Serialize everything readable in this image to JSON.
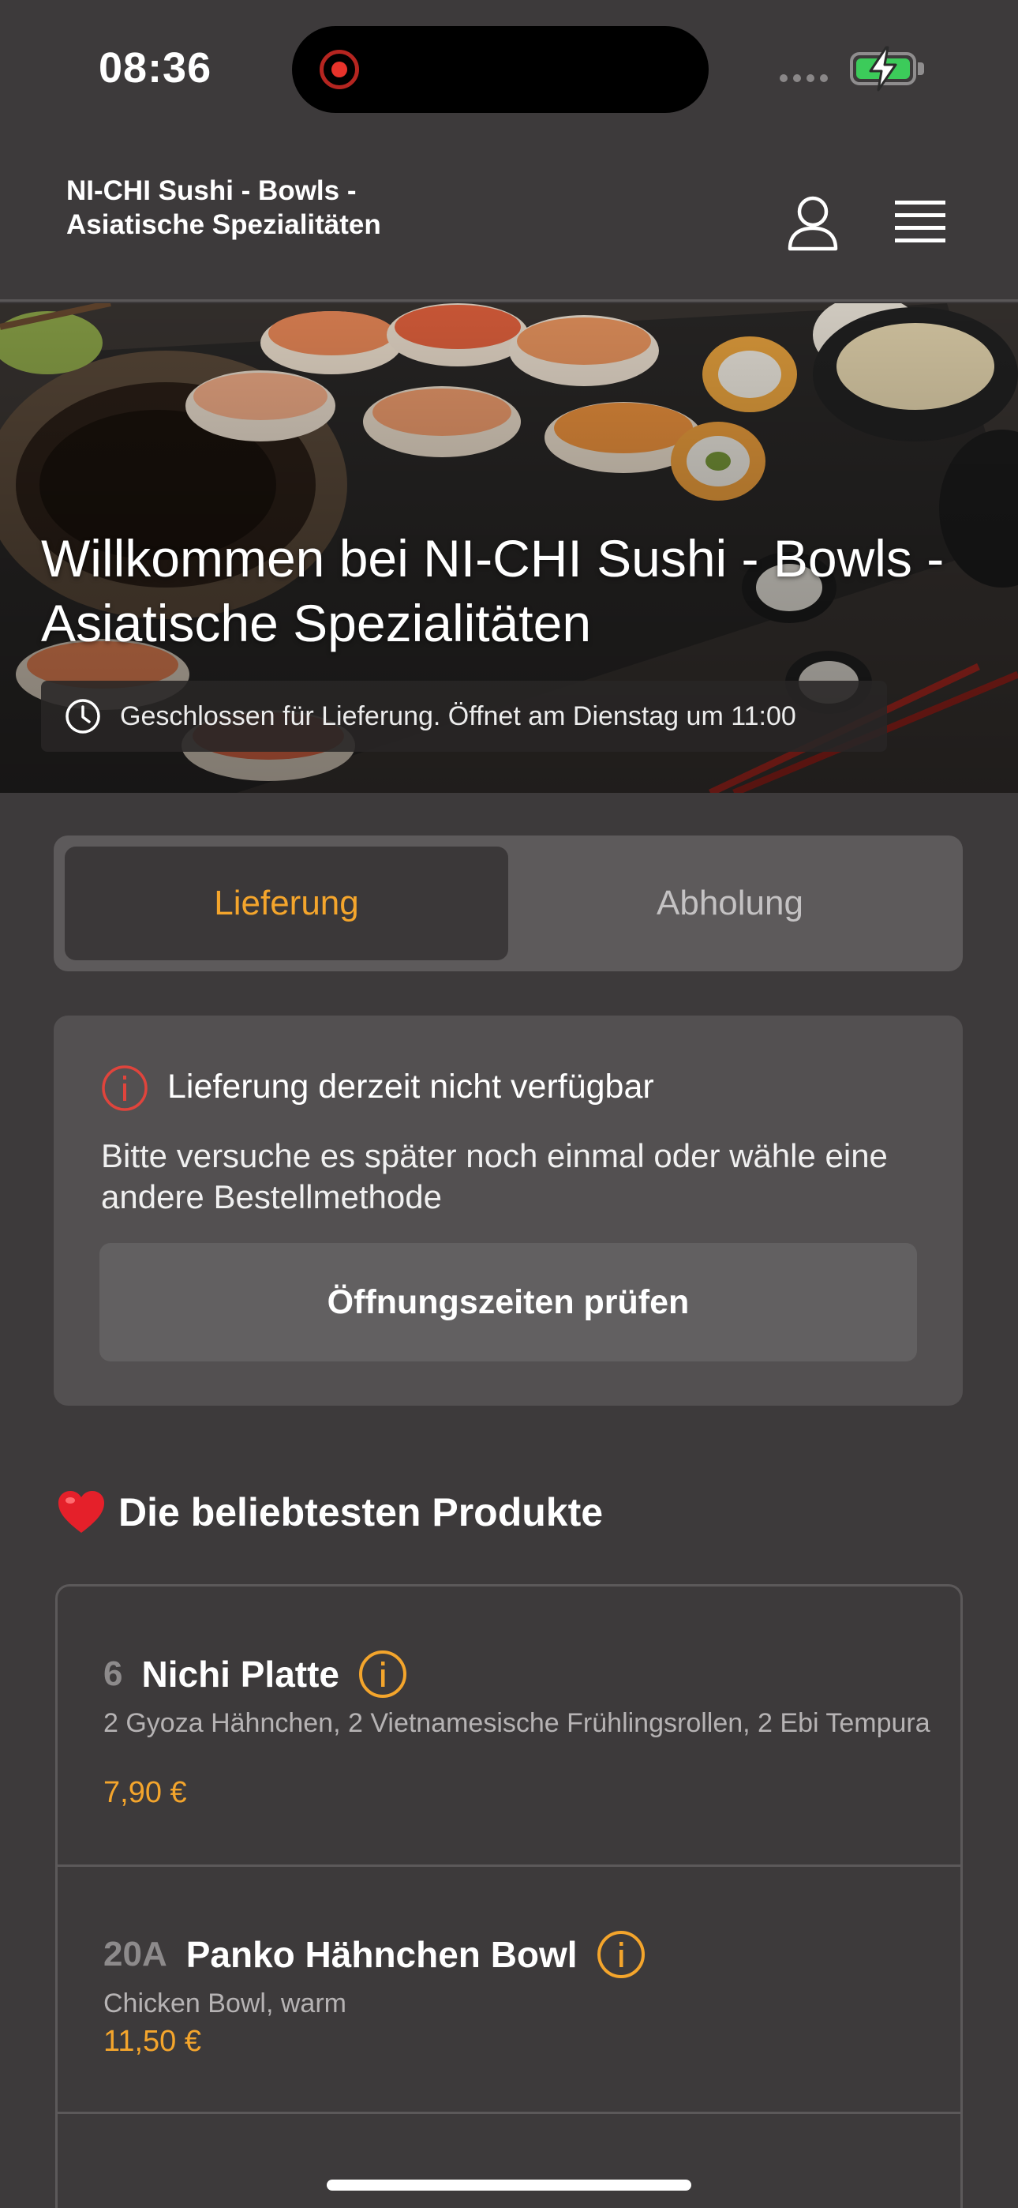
{
  "status_bar": {
    "time": "08:36",
    "recording_icon": "screen-recording-dot",
    "battery_icon": "battery-charging"
  },
  "header": {
    "title": "NI-CHI Sushi - Bowls - Asiatische Spezialitäten",
    "user_icon": "user-icon",
    "menu_icon": "hamburger-menu-icon"
  },
  "hero": {
    "title": "Willkommen bei NI-CHI Sushi - Bowls - Asiatische Spezialitäten",
    "status": "Geschlossen für Lieferung. Öffnet am Dienstag um 11:00",
    "status_icon": "clock-icon"
  },
  "tabs": {
    "delivery": "Lieferung",
    "pickup": "Abholung",
    "active": "delivery"
  },
  "notice": {
    "icon": "info-circle-icon",
    "title": "Lieferung derzeit nicht verfügbar",
    "text": "Bitte versuche es später noch einmal oder wähle eine andere Bestellmethode",
    "button": "Öffnungszeiten prüfen"
  },
  "popular": {
    "icon": "heart-icon",
    "title": "Die beliebtesten Produkte",
    "products": [
      {
        "number": "6",
        "name": "Nichi Platte",
        "description": "2 Gyoza Hähnchen, 2 Vietnamesische Frühlingsrollen, 2 Ebi Tempura",
        "price": "7,90 €"
      },
      {
        "number": "20A",
        "name": "Panko Hähnchen Bowl",
        "description": "Chicken Bowl, warm",
        "price": "11,50 €"
      }
    ]
  },
  "colors": {
    "background": "#3d3a3b",
    "accent": "#f4a52c",
    "error": "#e0443c",
    "card": "#535051"
  }
}
